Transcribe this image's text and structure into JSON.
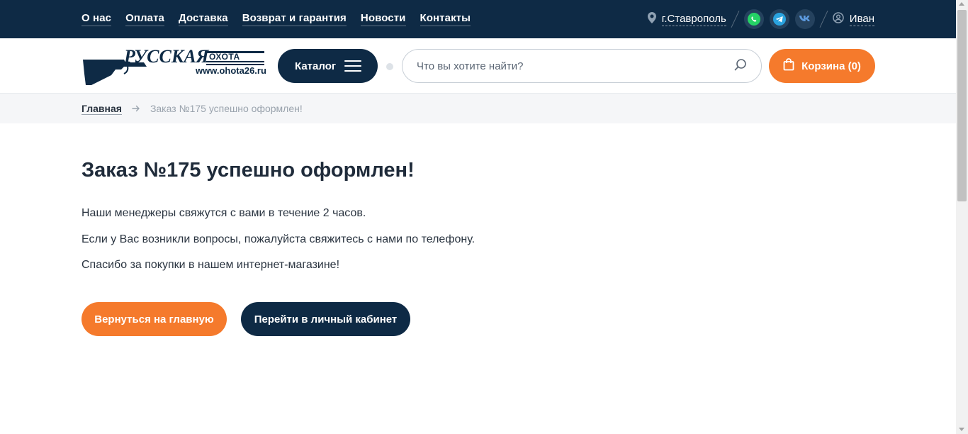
{
  "topnav": {
    "links": [
      "О нас",
      "Оплата",
      "Доставка",
      "Возврат и гарантия",
      "Новости",
      "Контакты"
    ],
    "city": "г.Ставрополь",
    "socials": [
      "whatsapp-icon",
      "telegram-icon",
      "vk-icon"
    ],
    "user": "Иван"
  },
  "header": {
    "logo_text": "РУССКАЯ ОХОТА",
    "logo_url": "www.ohota26.ru",
    "catalog_label": "Каталог",
    "search_placeholder": "Что вы хотите найти?",
    "cart_label": "Корзина (0)"
  },
  "breadcrumb": {
    "home": "Главная",
    "current": "Заказ №175 успешно оформлен!"
  },
  "main": {
    "title": "Заказ №175 успешно оформлен!",
    "lines": [
      "Наши менеджеры свяжутся с вами в течение 2 часов.",
      "Если у Вас возникли вопросы, пожалуйста свяжитесь с нами по телефону.",
      "Спасибо за покупки в нашем интернет-магазине!"
    ],
    "home_button": "Вернуться на главную",
    "account_button": "Перейти в личный кабинет"
  },
  "colors": {
    "navy": "#0e2a45",
    "accent": "#f57a2c",
    "breadcrumb_bg": "#f5f6f8"
  }
}
